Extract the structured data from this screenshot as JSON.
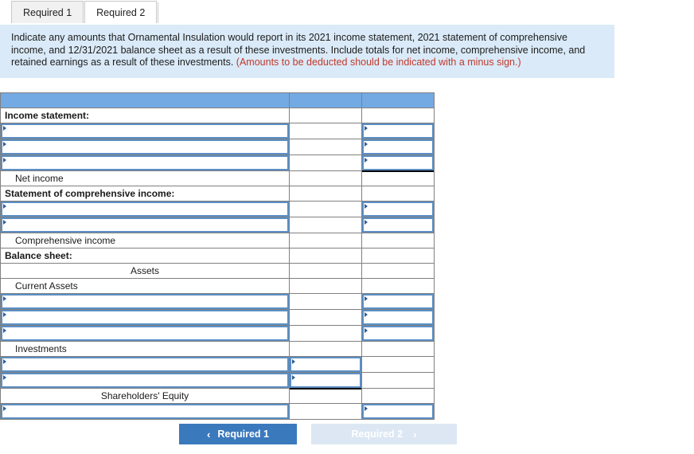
{
  "tabs": [
    {
      "label": "Required 1",
      "active": true
    },
    {
      "label": "Required 2",
      "active": false
    }
  ],
  "instructions": {
    "body": "Indicate any amounts that Ornamental Insulation would report in its 2021 income statement, 2021 statement of comprehensive income, and 12/31/2021 balance sheet as a result of these investments. Include totals for net income, comprehensive income, and retained earnings as a result of these investments. ",
    "warning": "(Amounts to be deducted should be indicated with a minus sign.)"
  },
  "colors": {
    "header_blue": "#74aae4",
    "panel_blue": "#daeaf8",
    "field_border": "#5b8fc4",
    "primary_button": "#3b79bd",
    "disabled_button": "#dce7f3",
    "warning_text": "#c0392b"
  },
  "worksheet": {
    "rows": [
      {
        "label": "",
        "style": "header"
      },
      {
        "label": "Income statement:",
        "style": "bold"
      },
      {
        "label": "",
        "style": "field",
        "col1_field": true,
        "col3_field": true
      },
      {
        "label": "",
        "style": "field",
        "col1_field": true,
        "col3_field": true
      },
      {
        "label": "",
        "style": "field",
        "col1_field": true,
        "col3_field": true,
        "col3_underline": true
      },
      {
        "label": "Net income",
        "style": "indent"
      },
      {
        "label": "Statement of comprehensive income:",
        "style": "bold"
      },
      {
        "label": "",
        "style": "field",
        "col1_field": true,
        "col3_field": true
      },
      {
        "label": "",
        "style": "field",
        "col1_field": true,
        "col3_field": true
      },
      {
        "label": "Comprehensive income",
        "style": "indent"
      },
      {
        "label": "Balance sheet:",
        "style": "bold"
      },
      {
        "label": "Assets",
        "style": "center"
      },
      {
        "label": "Current Assets",
        "style": "indent"
      },
      {
        "label": "",
        "style": "field",
        "col1_field": true,
        "col3_field": true
      },
      {
        "label": "",
        "style": "field",
        "col1_field": true,
        "col3_field": true
      },
      {
        "label": "",
        "style": "field",
        "col1_field": true,
        "col3_field": true
      },
      {
        "label": "Investments",
        "style": "indent"
      },
      {
        "label": "",
        "style": "field",
        "col1_field": true,
        "col2_field": true
      },
      {
        "label": "",
        "style": "field",
        "col1_field": true,
        "col2_field": true,
        "col2_underline": true
      },
      {
        "label": "Shareholders' Equity",
        "style": "center"
      },
      {
        "label": "",
        "style": "field",
        "col1_field": true,
        "col3_field": true
      }
    ]
  },
  "nav": {
    "prev_label": "Required 1",
    "prev_chevron": "‹",
    "next_label": "Required 2",
    "next_chevron": "›"
  }
}
